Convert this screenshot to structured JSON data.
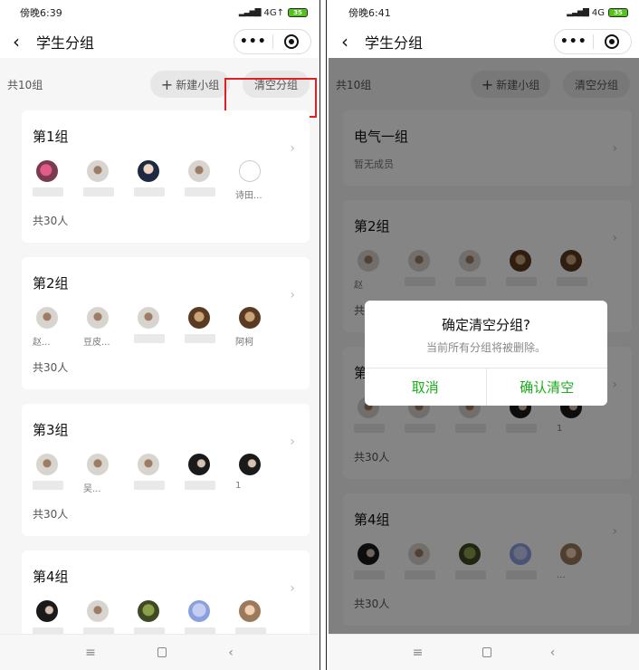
{
  "left": {
    "status": {
      "time": "傍晚6:39",
      "network": "4G↑",
      "battery": "35"
    },
    "nav": {
      "title": "学生分组",
      "more": "•••"
    },
    "toolbar": {
      "count": "共10组",
      "new_group": "新建小组",
      "clear": "清空分组"
    },
    "groups": [
      {
        "title": "第1组",
        "members": [
          {
            "avatar": "pink",
            "name": ""
          },
          {
            "avatar": "grey",
            "name": ""
          },
          {
            "avatar": "navy",
            "name": ""
          },
          {
            "avatar": "grey",
            "name": ""
          },
          {
            "avatar": "empty",
            "name": "诗田..."
          }
        ],
        "total": "共30人"
      },
      {
        "title": "第2组",
        "members": [
          {
            "avatar": "grey",
            "name": "赵..."
          },
          {
            "avatar": "grey",
            "name": "豆皮..."
          },
          {
            "avatar": "grey",
            "name": ""
          },
          {
            "avatar": "brown",
            "name": ""
          },
          {
            "avatar": "brown",
            "name": "阿柯"
          }
        ],
        "total": "共30人"
      },
      {
        "title": "第3组",
        "members": [
          {
            "avatar": "grey",
            "name": ""
          },
          {
            "avatar": "grey",
            "name": "吴..."
          },
          {
            "avatar": "grey",
            "name": ""
          },
          {
            "avatar": "dark",
            "name": ""
          },
          {
            "avatar": "dark",
            "name": "1"
          }
        ],
        "total": "共30人"
      },
      {
        "title": "第4组",
        "members": [
          {
            "avatar": "dark",
            "name": ""
          },
          {
            "avatar": "grey",
            "name": ""
          },
          {
            "avatar": "green",
            "name": ""
          },
          {
            "avatar": "blue",
            "name": ""
          },
          {
            "avatar": "tan",
            "name": ""
          }
        ],
        "total": ""
      }
    ]
  },
  "right": {
    "status": {
      "time": "傍晚6:41",
      "network": "4G",
      "battery": "35"
    },
    "nav": {
      "title": "学生分组",
      "more": "•••"
    },
    "toolbar": {
      "count": "共10组",
      "new_group": "新建小组",
      "clear": "清空分组"
    },
    "groups": [
      {
        "title": "电气一组",
        "sub": "暂无成员",
        "members": []
      },
      {
        "title": "第2组",
        "members": [
          {
            "avatar": "grey",
            "name": "赵"
          },
          {
            "avatar": "grey",
            "name": ""
          },
          {
            "avatar": "grey",
            "name": ""
          },
          {
            "avatar": "brown",
            "name": ""
          },
          {
            "avatar": "brown",
            "name": ""
          }
        ],
        "total": "共"
      },
      {
        "title": "第",
        "members": [
          {
            "avatar": "grey",
            "name": ""
          },
          {
            "avatar": "grey",
            "name": ""
          },
          {
            "avatar": "grey",
            "name": ""
          },
          {
            "avatar": "dark",
            "name": ""
          },
          {
            "avatar": "dark",
            "name": "1"
          }
        ],
        "total": "共30人"
      },
      {
        "title": "第4组",
        "members": [
          {
            "avatar": "dark",
            "name": ""
          },
          {
            "avatar": "grey",
            "name": ""
          },
          {
            "avatar": "green",
            "name": ""
          },
          {
            "avatar": "blue",
            "name": ""
          },
          {
            "avatar": "tan",
            "name": "..."
          }
        ],
        "total": "共30人"
      }
    ],
    "dialog": {
      "title": "确定清空分组?",
      "message": "当前所有分组将被删除。",
      "cancel": "取消",
      "confirm": "确认清空"
    }
  },
  "bottom_nav": {
    "menu": "≡",
    "back": "‹"
  },
  "colors": {
    "accent_green": "#1aad19",
    "highlight_red": "#e02020"
  }
}
